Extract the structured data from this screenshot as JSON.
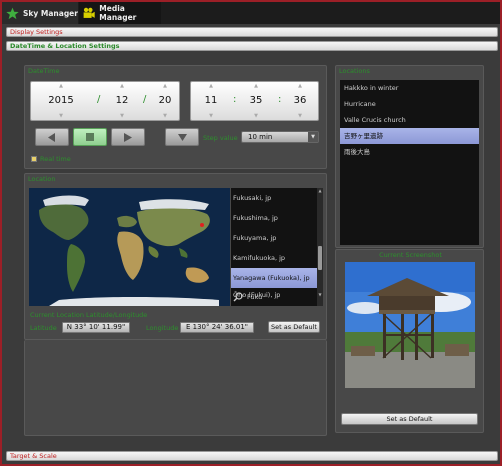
{
  "tabs": [
    {
      "label": "Sky Manager"
    },
    {
      "label": "Media Manager"
    }
  ],
  "sections": {
    "display_settings": "Display Settings",
    "datetime_location": "DateTime & Location Settings",
    "target_scale": "Target & Scale"
  },
  "datetime": {
    "title": "DateTime",
    "year": "2015",
    "month": "12",
    "day": "20",
    "hour": "11",
    "minute": "35",
    "second": "36",
    "date_sep": "/",
    "time_sep": ":",
    "step_label": "Step value",
    "step_value": "10 min",
    "realtime_label": "Real time"
  },
  "location": {
    "title": "Location",
    "cities": [
      "Fukusaki, jp",
      "Fukushima, jp",
      "Fukuyama, jp",
      "Kamifukuoka, jp",
      "Yanagawa (Fukuoka), jp",
      "Ōno (Fukui), jp"
    ],
    "selected_index": 4,
    "search_value": "Fuku",
    "current_location_label": "Current Location Latitude/Longitude",
    "latitude_label": "Latitude",
    "latitude": "N 33° 10' 11.99\"",
    "longitude_label": "Longitude",
    "longitude": "E 130° 24' 36.01\"",
    "set_default": "Set as Default"
  },
  "locations_panel": {
    "title": "Locations",
    "items": [
      "Hakkko in winter",
      "Hurricane",
      "Valle Crucis church",
      "吉野ヶ里遺跡",
      "雨後大島"
    ],
    "selected_index": 3
  },
  "screenshot_panel": {
    "title": "Current Screenshot",
    "set_default": "Set as Default"
  },
  "colors": {
    "accent_green": "#2d8f2d",
    "border_red": "#9c1f27",
    "selection": "#9aa6e0"
  }
}
